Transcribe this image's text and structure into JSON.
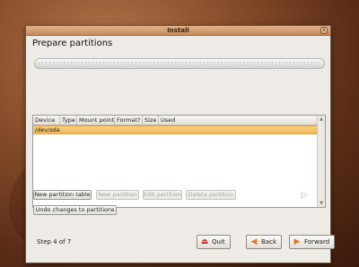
{
  "window": {
    "title": "Install",
    "close_glyph": "✕"
  },
  "page": {
    "heading": "Prepare partitions"
  },
  "table": {
    "columns": [
      "Device",
      "Type",
      "Mount point",
      "Format?",
      "Size",
      "Used"
    ],
    "rows": [
      {
        "device": "/dev/sda",
        "type": "",
        "mount": "",
        "format": "",
        "size": "",
        "used": ""
      }
    ]
  },
  "buttons": {
    "new_partition_table": "New partition table",
    "new_partition": "New partition",
    "edit_partition": "Edit partition",
    "delete_partition": "Delete partition",
    "undo": "Undo changes to partitions"
  },
  "footer": {
    "step": "Step 4 of 7",
    "quit": "Quit",
    "back": "Back",
    "forward": "Forward"
  },
  "icons": {
    "quit": "quit-icon",
    "back": "back-arrow-icon",
    "forward": "forward-arrow-icon"
  },
  "colors": {
    "selection": "#f0b75a",
    "titlebar": "#c78b5c",
    "back_arrow": "#e07a1a",
    "forward_arrow": "#e07a1a",
    "quit_icon": "#c0392b"
  }
}
